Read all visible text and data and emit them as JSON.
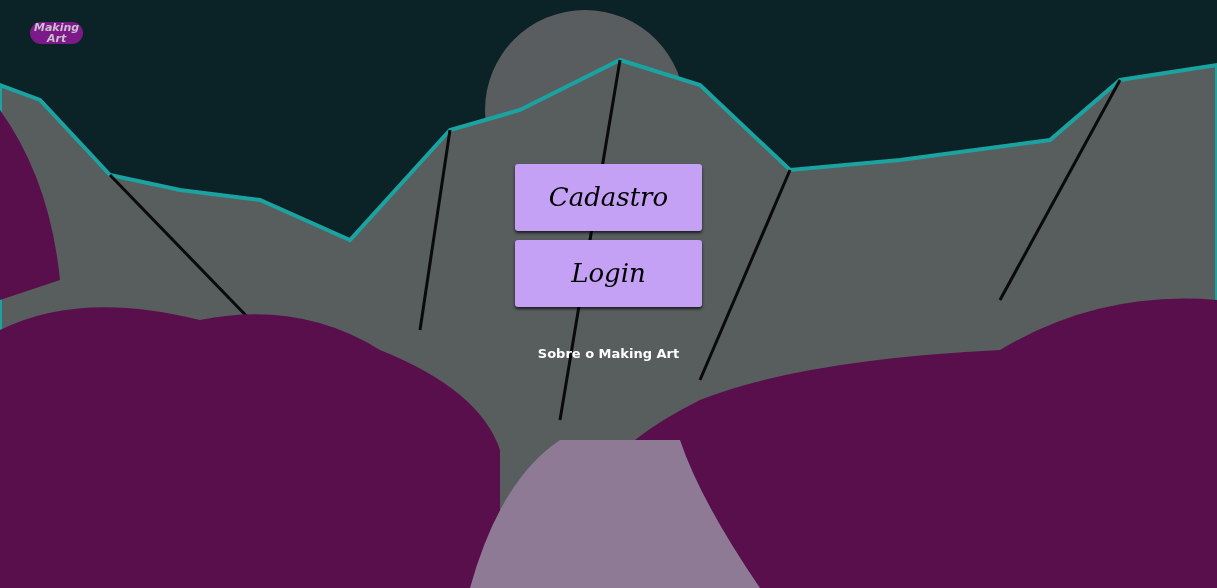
{
  "logo": {
    "lines": [
      "Making",
      "Art"
    ]
  },
  "buttons": [
    {
      "label": "Cadastro"
    },
    {
      "label": "Login"
    }
  ],
  "about_link": "Sobre o Making Art"
}
